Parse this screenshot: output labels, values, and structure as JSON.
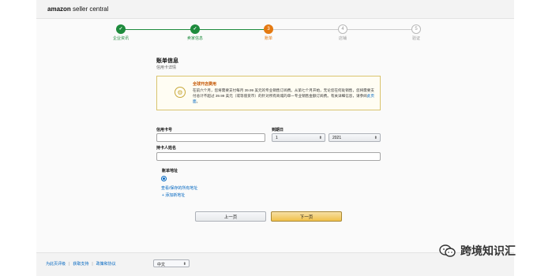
{
  "header": {
    "logo_brand": "amazon",
    "logo_text": " seller central"
  },
  "stepper": {
    "steps": [
      {
        "label": "企业资讯",
        "state": "done",
        "symbol": "✓"
      },
      {
        "label": "卖家信息",
        "state": "done",
        "symbol": "✓"
      },
      {
        "label": "账单",
        "state": "active",
        "symbol": "3"
      },
      {
        "label": "店铺",
        "state": "todo",
        "symbol": "4"
      },
      {
        "label": "验证",
        "state": "todo",
        "symbol": "5"
      }
    ],
    "colors": {
      "done": "#1e8b3d",
      "active": "#e47911",
      "todo": "#b9b9b9"
    }
  },
  "form": {
    "title": "账单信息",
    "subtitle": "信用卡详情",
    "notice": {
      "icon": "info-icon",
      "title": "全球开店费用",
      "text": "在前六个月，您将需要支付每月 39.99 美元的专业销售订阅费。从第七个月开始，无论您在何处销售，您将需要支付总计不超过 39.99 美元（或等值货币）的针对所有商城的单一专业销售金额订阅费。有关详细信息，请参阅",
      "link": "此页面",
      "end": "。"
    },
    "card_number_label": "信用卡号",
    "card_number_value": "",
    "expiry_label": "到期日",
    "expiry_month": "1",
    "expiry_year": "2021",
    "holder_label": "持卡人姓名",
    "holder_value": "",
    "billing_address_label": "账单地址",
    "address_option": "查看/保存的所有地址",
    "add_address": "+ 添加新地址"
  },
  "buttons": {
    "prev": "上一页",
    "next": "下一页"
  },
  "footer": {
    "links": [
      "为此页评级",
      "获取支持",
      "政策和协议"
    ],
    "language": "中文"
  },
  "watermark": {
    "text": "跨境知识汇"
  }
}
